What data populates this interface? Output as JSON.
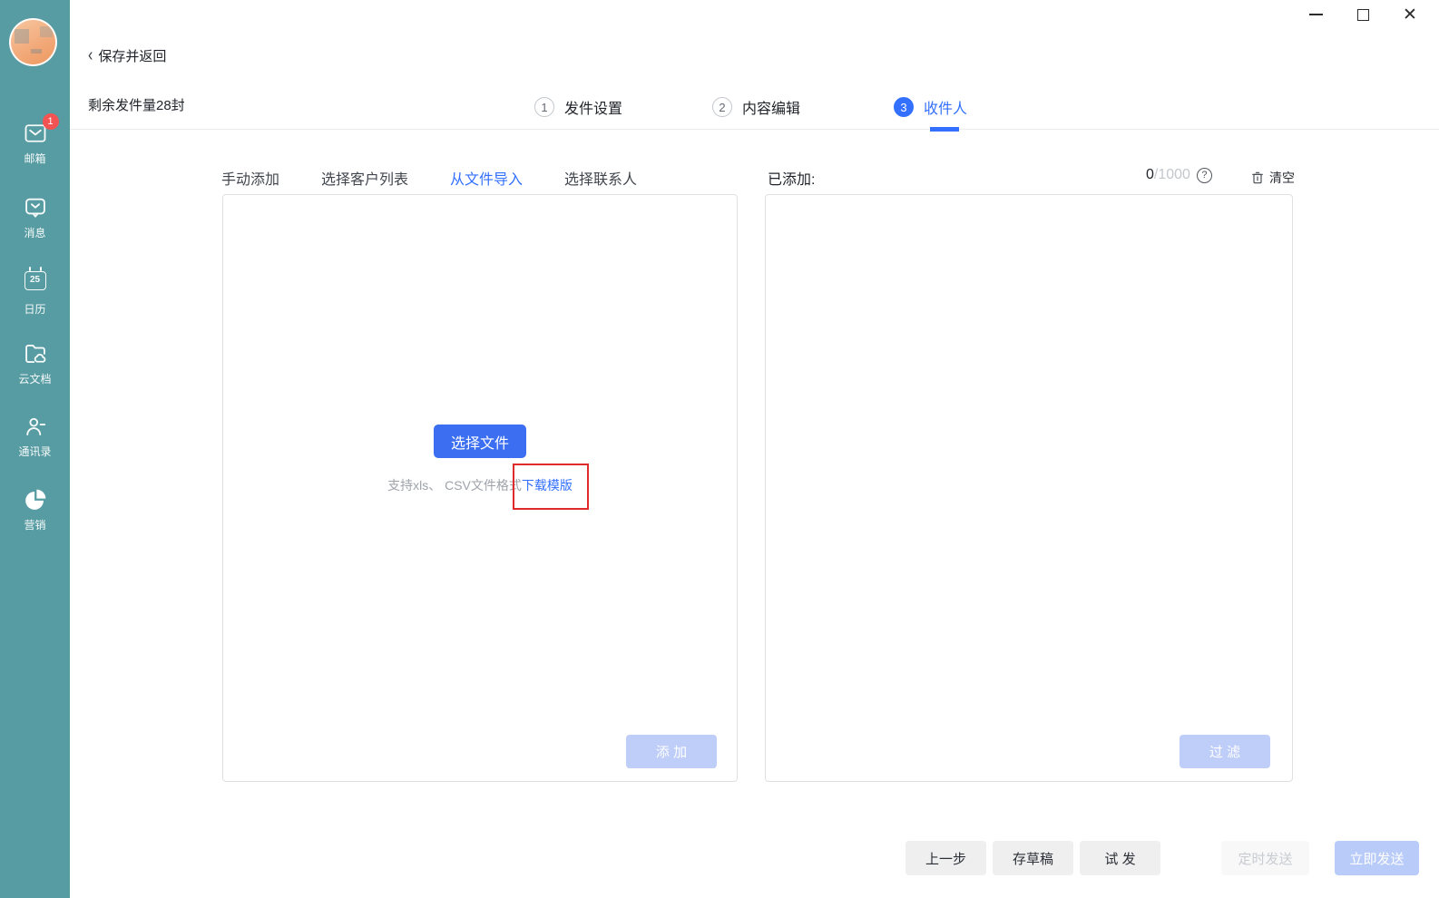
{
  "header": {
    "back_label": "保存并返回",
    "quota": "剩余发件量28封"
  },
  "sidebar": {
    "items": [
      {
        "label": "邮箱",
        "badge": "1"
      },
      {
        "label": "消息"
      },
      {
        "label": "日历",
        "day": "25"
      },
      {
        "label": "云文档"
      },
      {
        "label": "通讯录"
      },
      {
        "label": "营销"
      }
    ]
  },
  "steps": [
    {
      "num": "1",
      "label": "发件设置"
    },
    {
      "num": "2",
      "label": "内容编辑"
    },
    {
      "num": "3",
      "label": "收件人"
    }
  ],
  "tabs": [
    {
      "label": "手动添加"
    },
    {
      "label": "选择客户列表"
    },
    {
      "label": "从文件导入"
    },
    {
      "label": "选择联系人"
    }
  ],
  "import_panel": {
    "choose_file": "选择文件",
    "hint": "支持xls、 CSV文件格式",
    "download_link": "下载模版",
    "add_button": "添 加"
  },
  "added_panel": {
    "title": "已添加:",
    "count": "0",
    "limit": "/1000",
    "help": "?",
    "clear": "清空",
    "filter_button": "过 滤"
  },
  "footer": {
    "prev": "上一步",
    "draft": "存草稿",
    "test": "试 发",
    "schedule": "定时发送",
    "send": "立即发送"
  },
  "window": {
    "close_glyph": "✕"
  },
  "colors": {
    "sidebar": "#579CA2",
    "primary": "#3370FF",
    "badge": "#F35352",
    "annotation_box": "#DE2C2C"
  }
}
